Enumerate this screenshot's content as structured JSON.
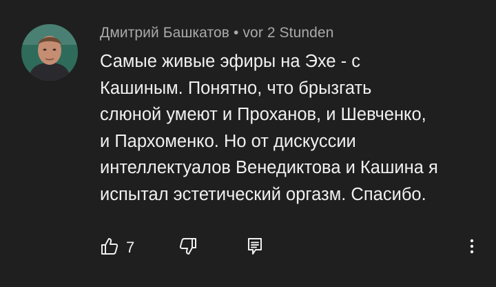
{
  "comment": {
    "author": "Дмитрий Башкатов",
    "separator": "•",
    "timestamp": "vor 2 Stunden",
    "text_lines": [
      "Самые живые эфиры на Эхе - с",
      "Кашиным. Понятно, что брызгать",
      "слюной умеют и Проханов, и Шевченко,",
      "и Пархоменко. Но от дискуссии",
      "интеллектуалов Венедиктова и Кашина я",
      "испытал эстетический оргазм. Спасибо."
    ],
    "like_count": "7"
  },
  "icons": {
    "like": "thumb-up-icon",
    "dislike": "thumb-down-icon",
    "reply": "comment-icon",
    "more": "more-vertical-icon"
  },
  "colors": {
    "background": "#1f1f1f",
    "text": "#f1f1f1",
    "meta": "#aaaaaa"
  }
}
